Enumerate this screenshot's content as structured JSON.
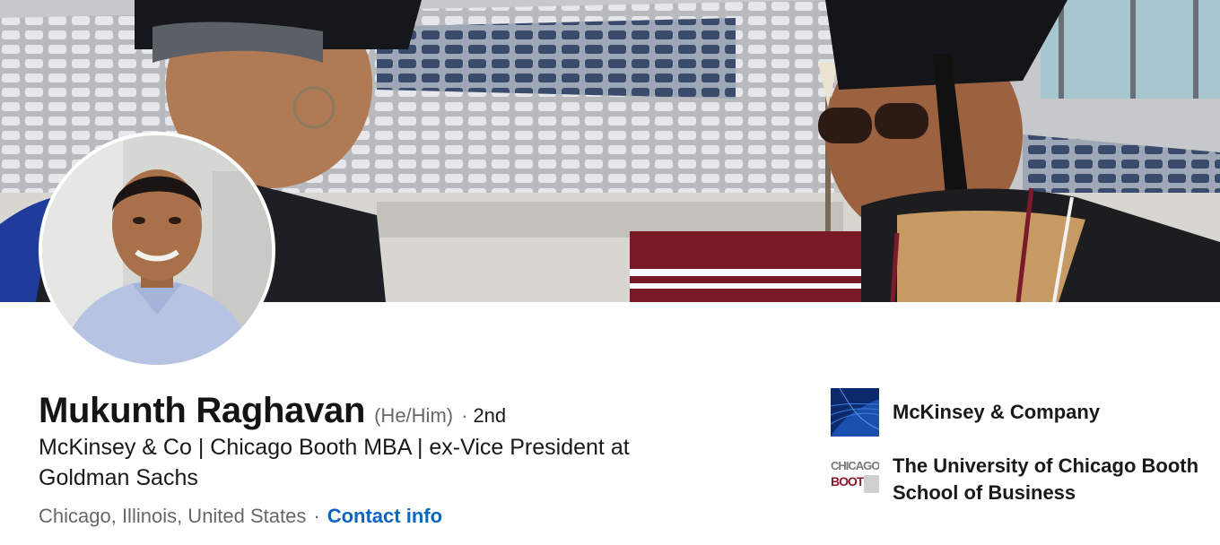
{
  "profile": {
    "name": "Mukunth Raghavan",
    "pronouns": "(He/Him)",
    "degree_separator": "·",
    "degree": "2nd",
    "headline": "McKinsey & Co | Chicago Booth MBA | ex-Vice President at Goldman Sachs",
    "location": "Chicago, Illinois, United States",
    "location_separator": "·",
    "contact_label": "Contact info"
  },
  "organizations": [
    {
      "name": "McKinsey & Company",
      "logo": "mckinsey-logo"
    },
    {
      "name": "The University of Chicago Booth School of Business",
      "logo": "chicago-booth-logo",
      "logo_text_top": "CHICAGO",
      "logo_text_bottom": "BOOTH"
    }
  ],
  "colors": {
    "link": "#0a66c2",
    "mckinsey_blue": "#0b2a6b",
    "booth_maroon": "#8a1a2b"
  }
}
